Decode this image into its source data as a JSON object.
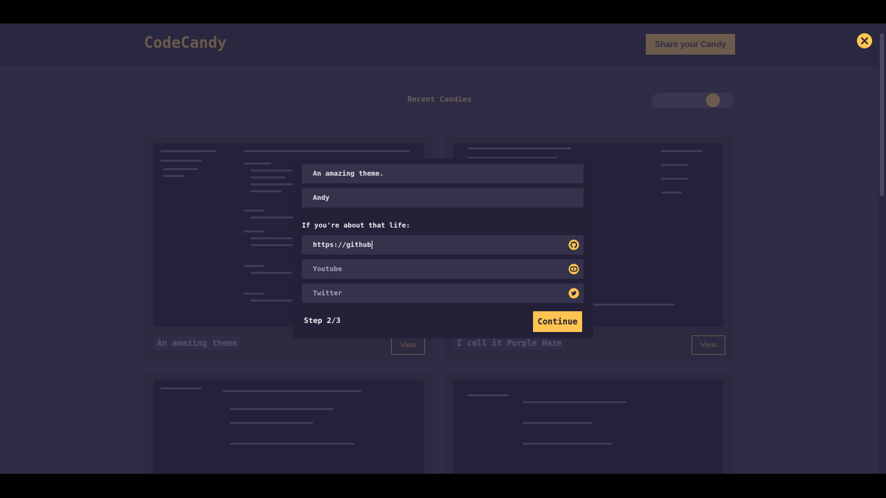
{
  "header": {
    "logo": "CodeCandy",
    "share_label": "Share your Candy"
  },
  "section": {
    "title": "Recent Candies"
  },
  "cards": [
    {
      "title": "An amazing theme",
      "view_label": "View"
    },
    {
      "title": "I call it Purple Haze",
      "view_label": "View"
    }
  ],
  "modal": {
    "description_value": "An amazing theme.",
    "author_value": "Andy",
    "social_label": "If you're about that life:",
    "github_value": "https://github",
    "youtube_placeholder": "Youtube",
    "twitter_placeholder": "Twitter",
    "step_label": "Step 2/3",
    "continue_label": "Continue"
  },
  "colors": {
    "accent": "#ffc451",
    "overlay_bg": "#2f2c45",
    "modal_bg": "#232037",
    "field_bg": "#35324b"
  },
  "icons": {
    "close": "close-icon",
    "github": "github-icon",
    "youtube": "youtube-icon",
    "twitter": "twitter-icon"
  }
}
